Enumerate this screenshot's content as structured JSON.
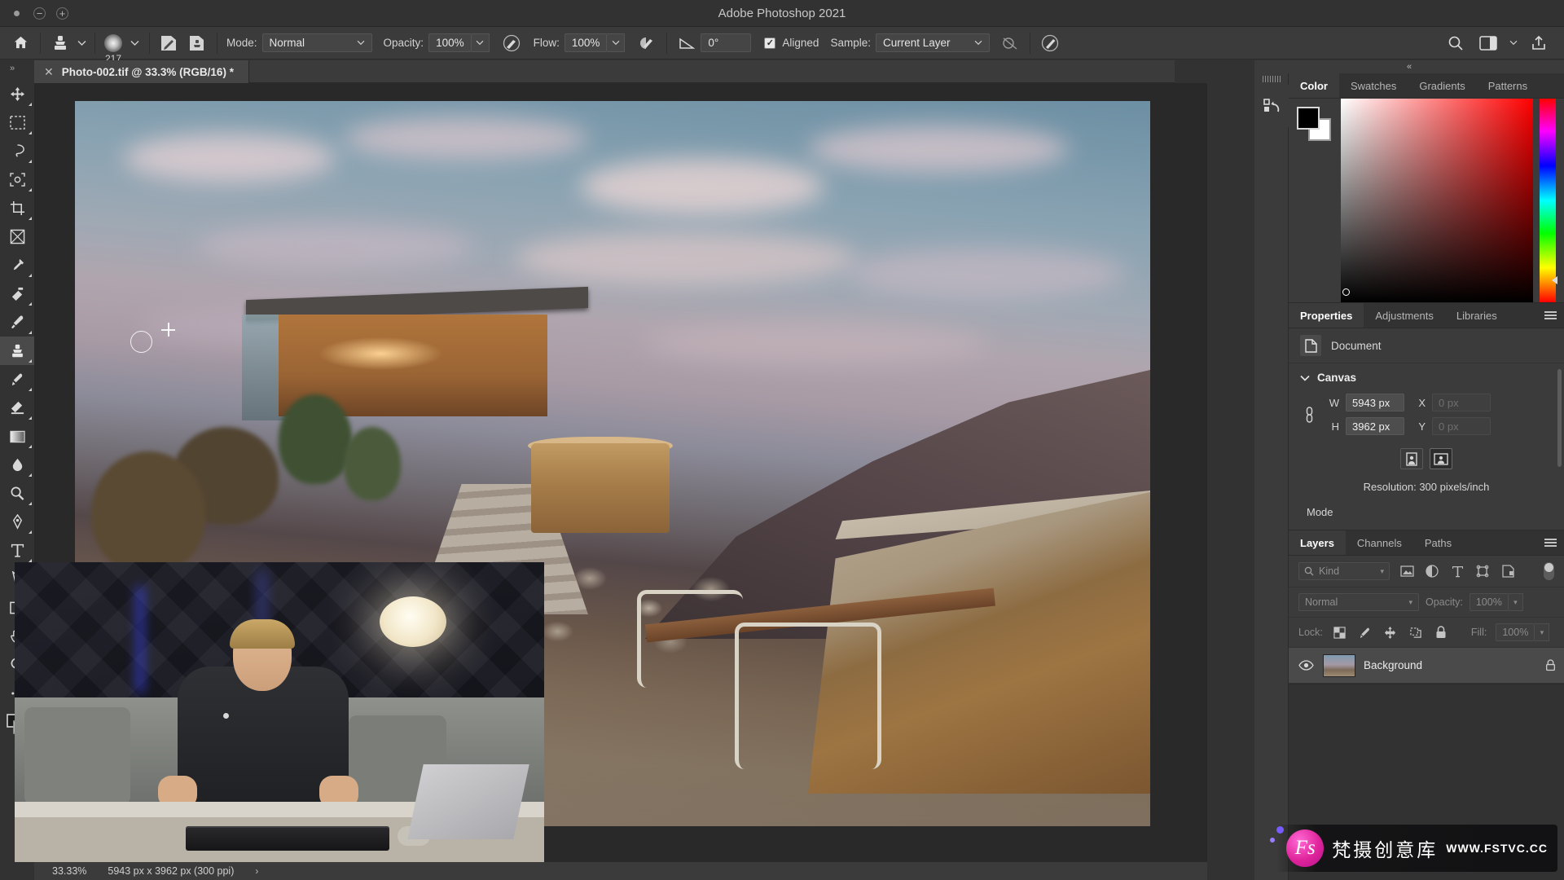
{
  "window": {
    "title": "Adobe Photoshop 2021",
    "buttons": [
      "close-dot",
      "minimize",
      "maximize"
    ]
  },
  "options_bar": {
    "home_icon": "home-icon",
    "tool_icon": "clone-stamp-icon",
    "tool_caret": "chevron-down-icon",
    "brush_preview_icon": "soft-round-brush-icon",
    "brush_size": "217",
    "brush_caret": "chevron-down-icon",
    "brush_settings_icon": "brush-panel-icon",
    "clone_source_icon": "clone-source-panel-icon",
    "mode_label": "Mode:",
    "mode_value": "Normal",
    "opacity_label": "Opacity:",
    "opacity_value": "100%",
    "airbrush_icon": "airbrush-pressure-icon",
    "flow_label": "Flow:",
    "flow_value": "100%",
    "smoothing_icon": "smoothing-icon",
    "angle_icon": "brush-angle-icon",
    "angle_value": "0°",
    "aligned_label": "Aligned",
    "aligned_checked": true,
    "sample_label": "Sample:",
    "sample_value": "Current Layer",
    "ignore_adjustment_icon": "ignore-adjustment-layers-icon",
    "tablet_pressure_icon": "tablet-pressure-size-icon",
    "search_icon": "search-icon",
    "workspace_icon": "workspace-switcher-icon",
    "workspace_caret": "chevron-down-icon",
    "share_icon": "share-icon"
  },
  "left_collapse": "»",
  "tools": [
    {
      "name": "move-tool",
      "icon": "move-arrow-icon",
      "active": false,
      "has_more": true
    },
    {
      "name": "rectangular-marquee-tool",
      "icon": "marquee-dashed-rect-icon",
      "active": false,
      "has_more": true
    },
    {
      "name": "lasso-tool",
      "icon": "lasso-icon",
      "active": false,
      "has_more": true
    },
    {
      "name": "object-selection-tool",
      "icon": "object-selection-icon",
      "active": false,
      "has_more": true
    },
    {
      "name": "crop-tool",
      "icon": "crop-icon",
      "active": false,
      "has_more": true
    },
    {
      "name": "frame-tool",
      "icon": "frame-icon",
      "active": false,
      "has_more": false
    },
    {
      "name": "eyedropper-tool",
      "icon": "eyedropper-icon",
      "active": false,
      "has_more": true
    },
    {
      "name": "spot-healing-brush-tool",
      "icon": "healing-brush-icon",
      "active": false,
      "has_more": true
    },
    {
      "name": "brush-tool",
      "icon": "paint-brush-icon",
      "active": false,
      "has_more": true
    },
    {
      "name": "clone-stamp-tool",
      "icon": "clone-stamp-icon",
      "active": true,
      "has_more": true
    },
    {
      "name": "history-brush-tool",
      "icon": "history-brush-icon",
      "active": false,
      "has_more": true
    },
    {
      "name": "eraser-tool",
      "icon": "eraser-icon",
      "active": false,
      "has_more": true
    },
    {
      "name": "gradient-tool",
      "icon": "gradient-icon",
      "active": false,
      "has_more": true
    },
    {
      "name": "blur-tool",
      "icon": "water-drop-icon",
      "active": false,
      "has_more": true
    },
    {
      "name": "dodge-tool",
      "icon": "dodge-icon",
      "active": false,
      "has_more": true
    },
    {
      "name": "pen-tool",
      "icon": "pen-icon",
      "active": false,
      "has_more": true
    },
    {
      "name": "type-tool",
      "icon": "type-t-icon",
      "active": false,
      "has_more": true
    },
    {
      "name": "path-selection-tool",
      "icon": "path-arrow-icon",
      "active": false,
      "has_more": true
    },
    {
      "name": "shape-tool",
      "icon": "rectangle-shape-icon",
      "active": false,
      "has_more": true
    },
    {
      "name": "hand-tool",
      "icon": "hand-icon",
      "active": false,
      "has_more": true
    },
    {
      "name": "zoom-tool",
      "icon": "magnifier-icon",
      "active": false,
      "has_more": false
    },
    {
      "name": "edit-toolbar",
      "icon": "ellipsis-icon",
      "active": false,
      "has_more": false
    },
    {
      "name": "foreground-background-colors",
      "icon": "color-swatches-icon",
      "active": false,
      "has_more": false
    }
  ],
  "document_tab": {
    "close_icon": "close-x-icon",
    "label": "Photo-002.tif @ 33.3% (RGB/16) *"
  },
  "status_bar": {
    "zoom": "33.33%",
    "dimensions": "5943 px x 3962 px (300 ppi)",
    "arrow_icon": "chevron-right-icon"
  },
  "dock": {
    "collapse_icon": "«",
    "rail_buttons": [
      {
        "name": "history-panel-button",
        "icon": "history-undo-icon"
      }
    ]
  },
  "color_panel": {
    "tabs": [
      {
        "label": "Color",
        "active": true
      },
      {
        "label": "Swatches",
        "active": false
      },
      {
        "label": "Gradients",
        "active": false
      },
      {
        "label": "Patterns",
        "active": false
      }
    ],
    "menu_icon": "panel-menu-icon",
    "foreground_color": "#000000",
    "background_color": "#ffffff",
    "field_gradient_from": "#ffffff",
    "field_gradient_to": "#ff0000"
  },
  "properties_panel": {
    "tabs": [
      {
        "label": "Properties",
        "active": true
      },
      {
        "label": "Adjustments",
        "active": false
      },
      {
        "label": "Libraries",
        "active": false
      }
    ],
    "menu_icon": "panel-menu-icon",
    "doc_icon": "document-icon",
    "doc_label": "Document",
    "canvas_section": {
      "chevron_icon": "chevron-down-icon",
      "title": "Canvas",
      "link_icon": "link-chain-icon",
      "w_label": "W",
      "w_value": "5943 px",
      "x_label": "X",
      "x_placeholder": "0 px",
      "h_label": "H",
      "h_value": "3962 px",
      "y_label": "Y",
      "y_placeholder": "0 px",
      "portrait_icon": "portrait-orientation-icon",
      "landscape_icon": "landscape-orientation-icon",
      "selected_orientation": "landscape",
      "resolution": "Resolution: 300 pixels/inch",
      "mode_label": "Mode"
    }
  },
  "layers_panel": {
    "tabs": [
      {
        "label": "Layers",
        "active": true
      },
      {
        "label": "Channels",
        "active": false
      },
      {
        "label": "Paths",
        "active": false
      }
    ],
    "menu_icon": "panel-menu-icon",
    "filter": {
      "search_icon": "search-icon",
      "kind_label": "Kind",
      "caret_icon": "chevron-down-icon",
      "filter_icons": [
        "pixel-layer-filter-icon",
        "adjustment-layer-filter-icon",
        "type-layer-filter-icon",
        "shape-layer-filter-icon",
        "smart-object-filter-icon"
      ],
      "toggle_icon": "filter-toggle-switch"
    },
    "blend": {
      "mode_value": "Normal",
      "caret_icon": "chevron-down-icon",
      "opacity_label": "Opacity:",
      "opacity_value": "100%"
    },
    "lock": {
      "label": "Lock:",
      "icons": [
        "lock-transparent-pixels-icon",
        "lock-image-pixels-icon",
        "lock-position-icon",
        "lock-artboard-nesting-icon",
        "lock-all-icon"
      ],
      "fill_label": "Fill:",
      "fill_value": "100%"
    },
    "layers": [
      {
        "name": "Background",
        "visible": true,
        "eye_icon": "eye-icon",
        "lock_icon": "lock-icon",
        "thumbnail": "photo-thumbnail"
      }
    ]
  },
  "watermark": {
    "logo_text": "Fs",
    "brand_cn": "梵摄创意库",
    "url": "WWW.FSTVC.CC"
  }
}
